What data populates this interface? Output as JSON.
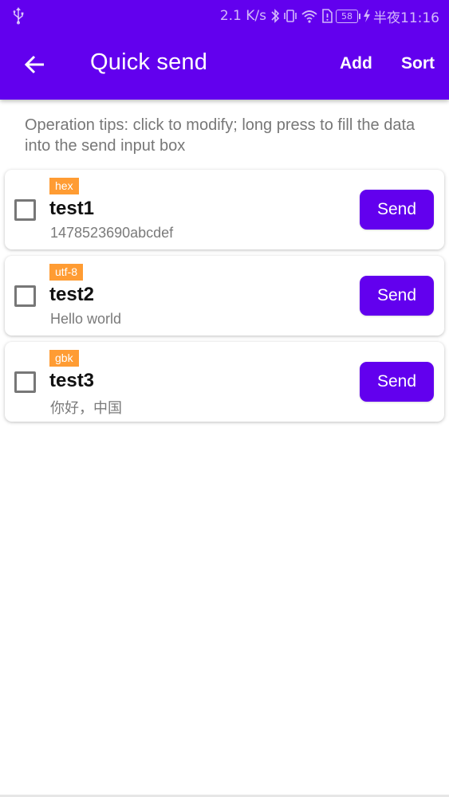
{
  "status_bar": {
    "speed": "2.1 K/s",
    "battery": "58",
    "time": "半夜11:16",
    "icons": [
      "usb-icon",
      "bluetooth-icon",
      "vibrate-icon",
      "wifi-icon",
      "sim-alert-icon",
      "battery-icon",
      "charging-bolt-icon"
    ]
  },
  "app_bar": {
    "title": "Quick send",
    "back_icon": "arrow-left-icon",
    "actions": {
      "add": "Add",
      "sort": "Sort"
    },
    "color": "#6200ee"
  },
  "tips": "Operation tips: click to modify; long press to fill the data into the send input box",
  "items": [
    {
      "encoding": "hex",
      "title": "test1",
      "data": "1478523690abcdef",
      "send_label": "Send",
      "checked": false
    },
    {
      "encoding": "utf-8",
      "title": "test2",
      "data": "Hello world",
      "send_label": "Send",
      "checked": false
    },
    {
      "encoding": "gbk",
      "title": "test3",
      "data": "你好，中国",
      "send_label": "Send",
      "checked": false
    }
  ],
  "colors": {
    "accent": "#6200ee",
    "badge": "#ff9c33"
  }
}
